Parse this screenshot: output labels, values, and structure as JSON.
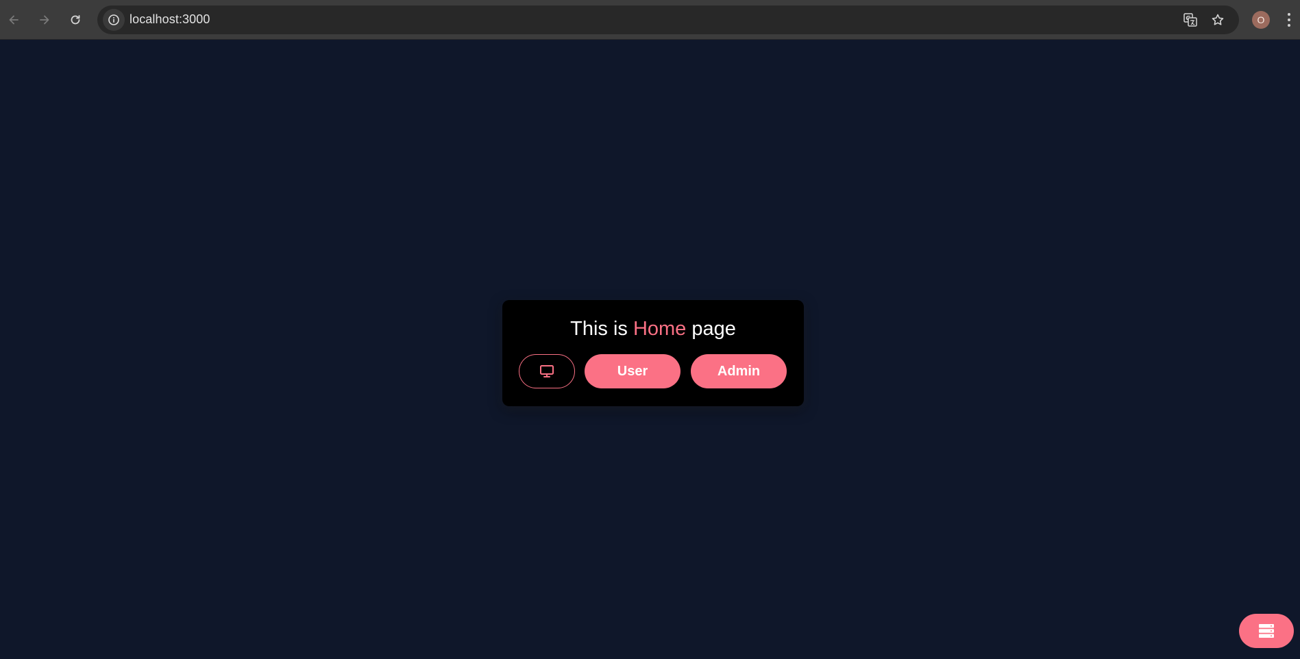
{
  "browser": {
    "url": "localhost:3000",
    "profile_initial": "O",
    "icons": {
      "back": "arrow-left-icon",
      "forward": "arrow-right-icon",
      "reload": "reload-icon",
      "site_info": "info-icon",
      "translate": "translate-icon",
      "bookmark": "star-icon",
      "menu": "kebab-menu-icon"
    }
  },
  "card": {
    "title_prefix": "This is ",
    "title_highlight": "Home",
    "title_suffix": " page",
    "theme_button_icon": "monitor-icon",
    "user_label": "User",
    "admin_label": "Admin"
  },
  "fab": {
    "icon": "server-stack-icon"
  },
  "colors": {
    "background": "#0f172a",
    "card": "#000000",
    "accent": "#fb7185",
    "chrome": "#3c3c3c",
    "omnibox": "#282828"
  }
}
